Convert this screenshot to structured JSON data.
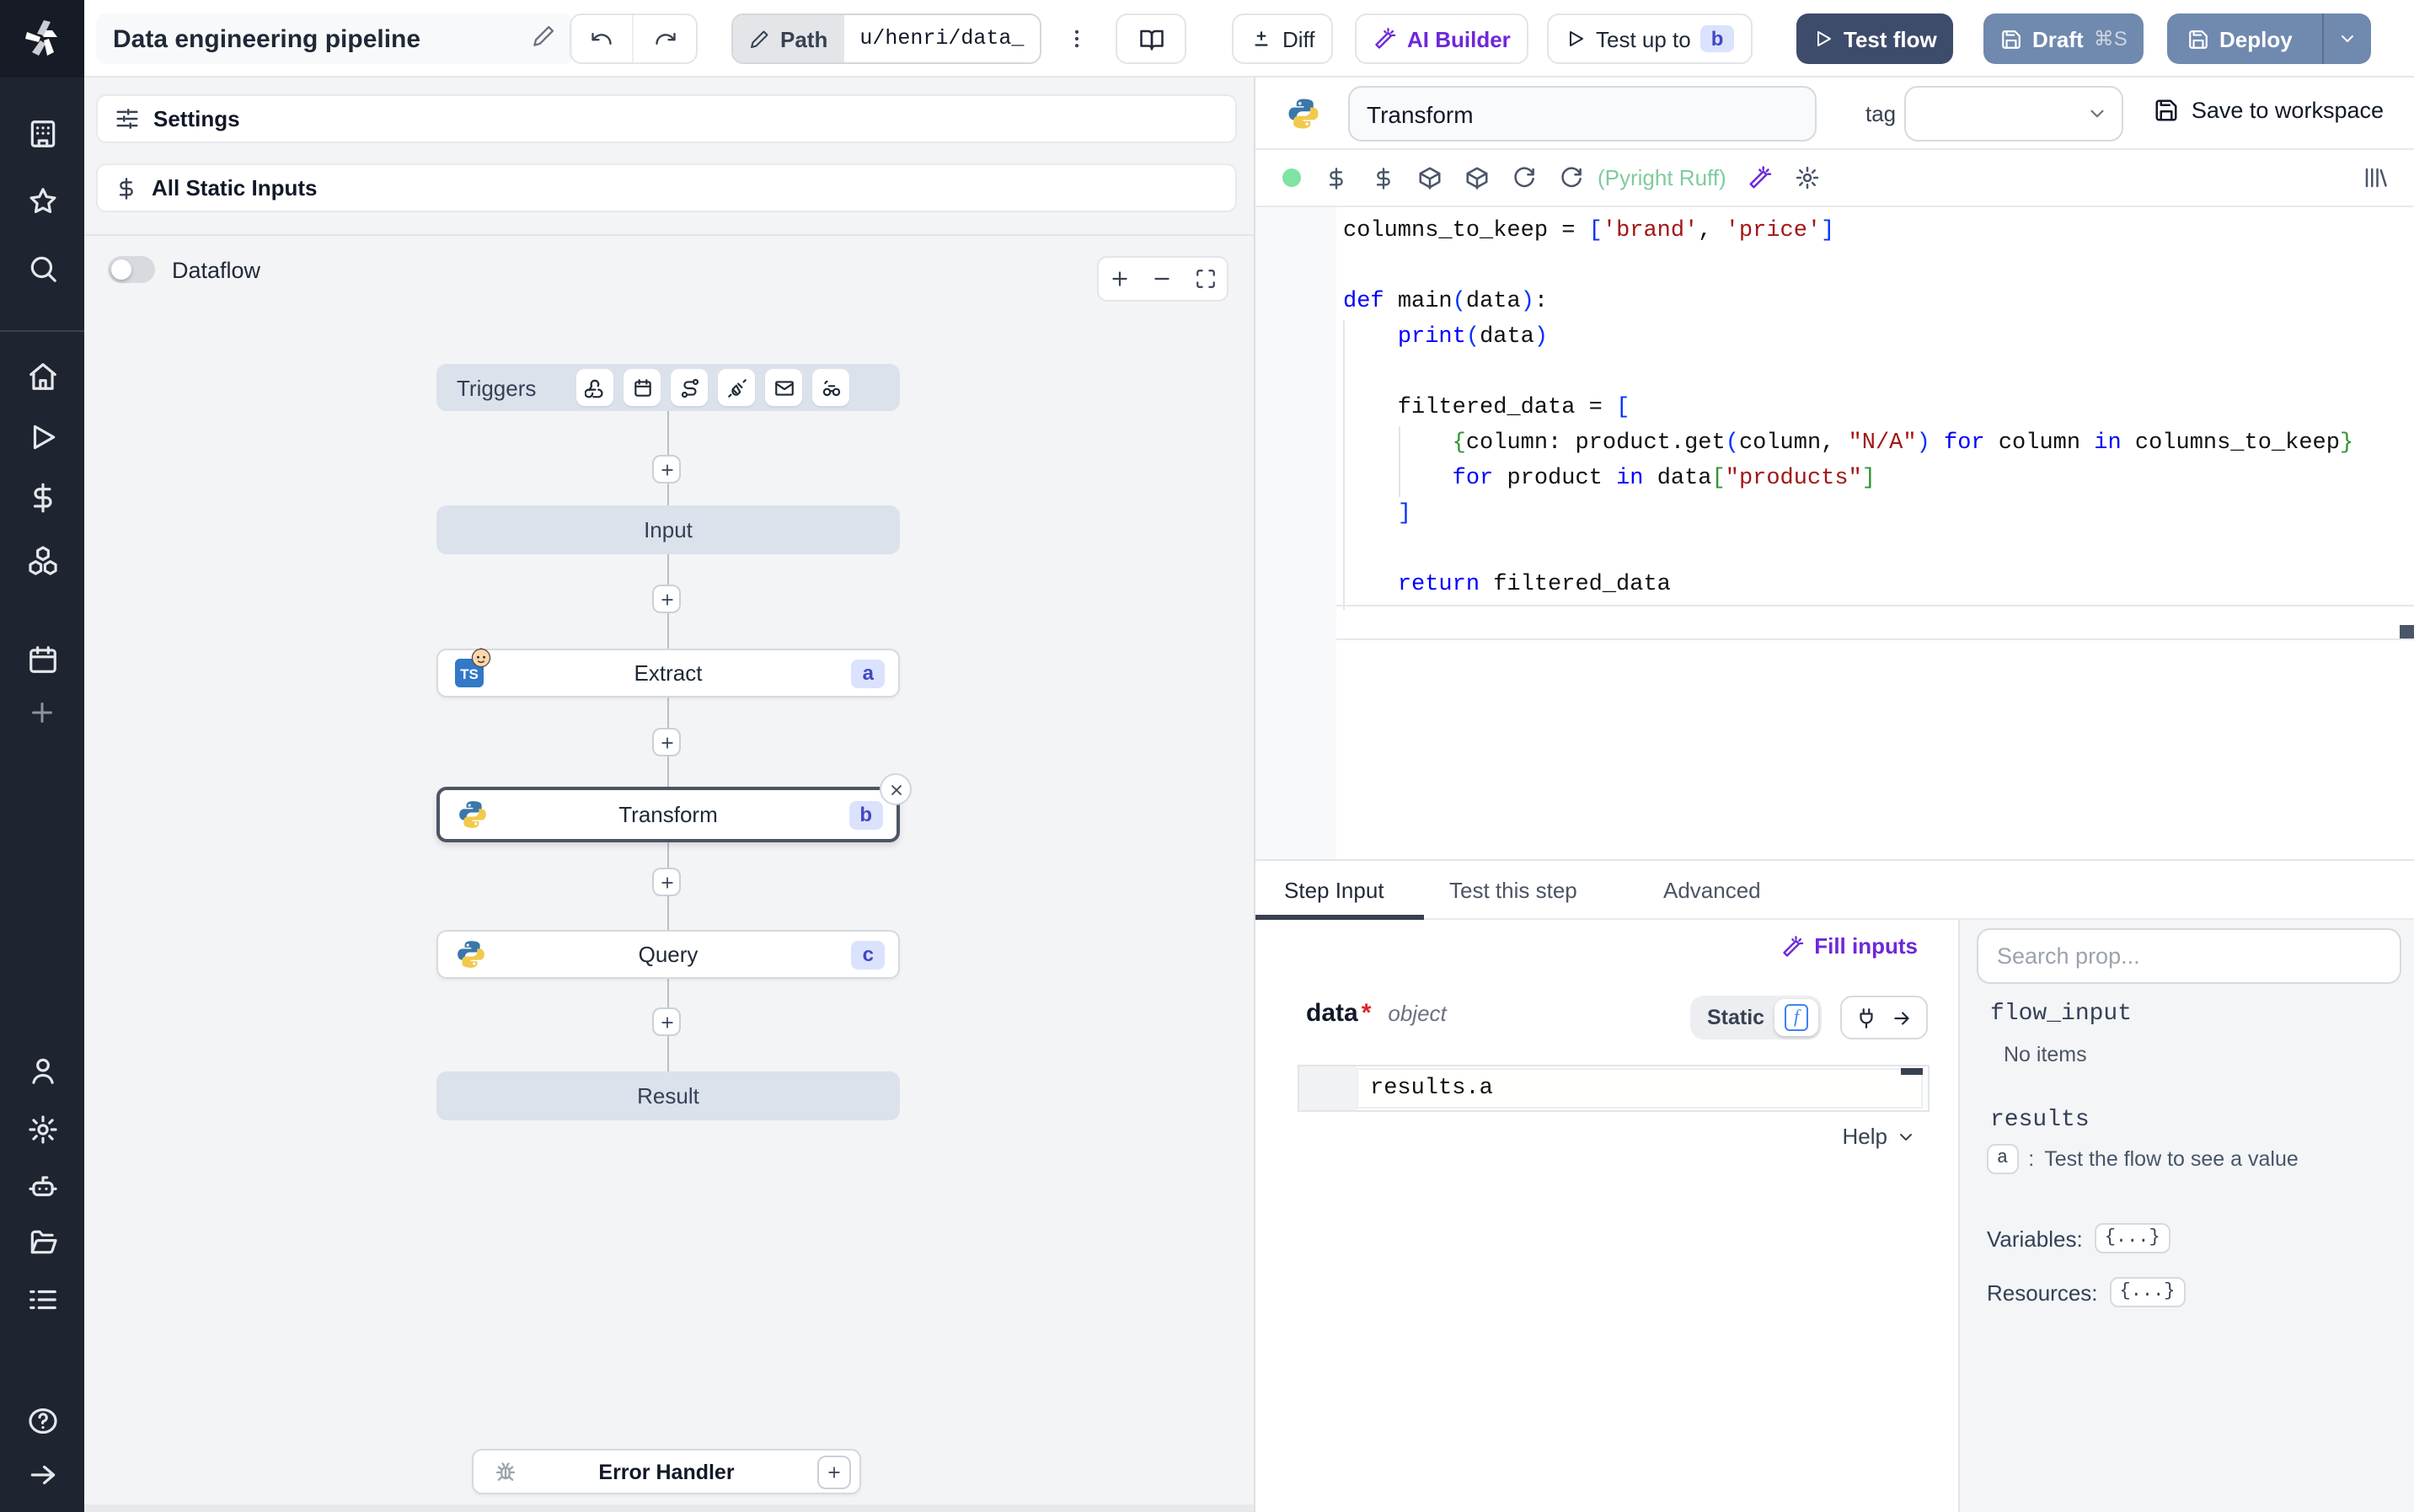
{
  "colors": {
    "accent_purple": "#6d28d9",
    "test_flow_bg": "#3e4c6b",
    "deploy_bg": "#7089ae",
    "badge_bg": "#dbe2fd",
    "badge_text": "#4346c4",
    "lint_green": "#7fcb9d",
    "status_dot": "#7fe3a3",
    "sidebar_bg": "#1e2430",
    "canvas_bg": "#f3f4f6",
    "node_slate_bg": "#dbe2ec",
    "selected_node_border": "#4b5563"
  },
  "topbar": {
    "title": "Data engineering pipeline",
    "path_label": "Path",
    "path_value": "u/henri/data_",
    "diff_label": "Diff",
    "ai_builder_label": "AI Builder",
    "test_up_to_label": "Test up to",
    "test_up_to_badge": "b",
    "test_flow_label": "Test flow",
    "draft_label": "Draft",
    "draft_shortcut": "⌘S",
    "deploy_label": "Deploy"
  },
  "sidebar": {
    "icons": [
      "windmill-logo",
      "workspaces-icon",
      "favorites-icon",
      "search-icon",
      "home-icon",
      "runs-icon",
      "variables-icon",
      "resources-icon",
      "schedules-icon",
      "create-icon",
      "account-icon",
      "settings-icon",
      "ai-agents-icon",
      "folders-icon",
      "audit-logs-icon",
      "help-icon",
      "expand-sidebar-icon"
    ]
  },
  "canvas": {
    "settings_label": "Settings",
    "all_static_inputs_label": "All Static Inputs",
    "dataflow_label": "Dataflow",
    "zoom_controls": [
      "zoom-in-icon",
      "zoom-out-icon",
      "fit-view-icon"
    ]
  },
  "flow": {
    "triggers_label": "Triggers",
    "trigger_icons": [
      "webhook-icon",
      "schedule-icon",
      "http-route-icon",
      "websocket-icon",
      "email-icon",
      "poll-icon"
    ],
    "nodes": {
      "input": {
        "label": "Input"
      },
      "extract": {
        "label": "Extract",
        "badge": "a",
        "language": "typescript"
      },
      "transform": {
        "label": "Transform",
        "badge": "b",
        "language": "python",
        "selected": true
      },
      "query": {
        "label": "Query",
        "badge": "c",
        "language": "python"
      },
      "result": {
        "label": "Result"
      },
      "error_handler": {
        "label": "Error Handler"
      }
    }
  },
  "editor": {
    "language": "python",
    "step_name": "Transform",
    "tag_label": "tag",
    "save_to_workspace_label": "Save to workspace",
    "lint_label": "(Pyright Ruff)",
    "toolbar_icons": [
      "run-status-dot",
      "static-inputs-dollar-icon",
      "variables-dollar-icon",
      "package-icon",
      "package-icon",
      "reset-icon",
      "reload-icon",
      "ai-fix-icon",
      "editor-settings-icon",
      "library-icon"
    ],
    "code_lines": [
      [
        [
          "p",
          "columns_to_keep = "
        ],
        [
          "b1",
          "["
        ],
        [
          "s",
          "'brand'"
        ],
        [
          "p",
          ", "
        ],
        [
          "s",
          "'price'"
        ],
        [
          "b1",
          "]"
        ]
      ],
      [],
      [
        [
          "k",
          "def"
        ],
        [
          "p",
          " main"
        ],
        [
          "b1",
          "("
        ],
        [
          "p",
          "data"
        ],
        [
          "b1",
          ")"
        ],
        [
          "p",
          ":"
        ]
      ],
      [
        [
          "p",
          "    "
        ],
        [
          "k",
          "print"
        ],
        [
          "b1",
          "("
        ],
        [
          "p",
          "data"
        ],
        [
          "b1",
          ")"
        ]
      ],
      [],
      [
        [
          "p",
          "    filtered_data = "
        ],
        [
          "b1",
          "["
        ]
      ],
      [
        [
          "p",
          "        "
        ],
        [
          "b2",
          "{"
        ],
        [
          "p",
          "column: product.get"
        ],
        [
          "b1",
          "("
        ],
        [
          "p",
          "column, "
        ],
        [
          "s",
          "\"N/A\""
        ],
        [
          "b1",
          ")"
        ],
        [
          "p",
          " "
        ],
        [
          "k",
          "for"
        ],
        [
          "p",
          " column "
        ],
        [
          "k",
          "in"
        ],
        [
          "p",
          " columns_to_keep"
        ],
        [
          "b2",
          "}"
        ]
      ],
      [
        [
          "p",
          "        "
        ],
        [
          "k",
          "for"
        ],
        [
          "p",
          " product "
        ],
        [
          "k",
          "in"
        ],
        [
          "p",
          " data"
        ],
        [
          "b2",
          "["
        ],
        [
          "s",
          "\"products\""
        ],
        [
          "b2",
          "]"
        ]
      ],
      [
        [
          "p",
          "    "
        ],
        [
          "b1",
          "]"
        ]
      ],
      [],
      [
        [
          "p",
          "    "
        ],
        [
          "k",
          "return"
        ],
        [
          "p",
          " filtered_data"
        ]
      ]
    ]
  },
  "step_panel": {
    "tabs": [
      "Step Input",
      "Test this step",
      "Advanced"
    ],
    "active_tab": "Step Input",
    "fill_inputs_label": "Fill inputs",
    "arg_name": "data",
    "arg_required_mark": "*",
    "arg_type": "object",
    "static_label": "Static",
    "function_glyph": "f",
    "expression_value": "results.a",
    "help_label": "Help"
  },
  "props_panel": {
    "search_placeholder": "Search prop...",
    "flow_input_label": "flow_input",
    "flow_input_empty": "No items",
    "results_label": "results",
    "result_key": "a",
    "result_separator": ":",
    "result_hint": "Test the flow to see a value",
    "variables_label": "Variables:",
    "variables_value": "{...}",
    "resources_label": "Resources:",
    "resources_value": "{...}"
  }
}
